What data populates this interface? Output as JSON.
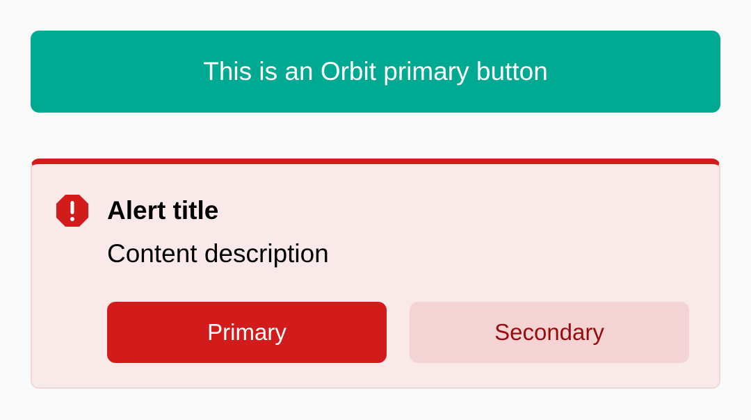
{
  "primary_button": {
    "label": "This is an Orbit primary button",
    "color": "#00a991"
  },
  "alert": {
    "type": "critical",
    "icon": "alert-octagon-icon",
    "title": "Alert title",
    "description": "Content description",
    "accent_color": "#d21c1c",
    "background_color": "#fae9e9",
    "actions": {
      "primary_label": "Primary",
      "secondary_label": "Secondary"
    }
  }
}
